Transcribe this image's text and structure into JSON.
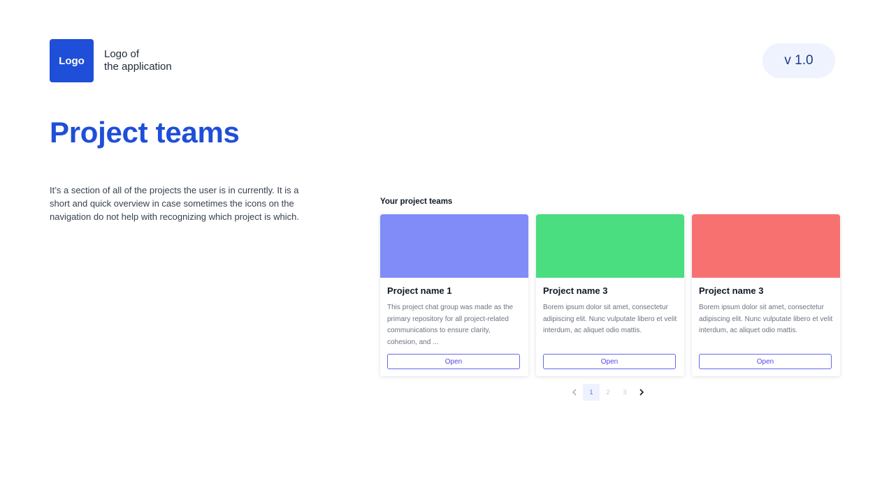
{
  "header": {
    "logo_text": "Logo",
    "logo_caption_line1": "Logo of",
    "logo_caption_line2": "the application",
    "version": "v 1.0"
  },
  "page": {
    "title": "Project teams",
    "description": "It’s a section of all of the projects the user is in currently. It is a short and quick overview in case sometimes the icons on the navigation do not help with recognizing which project is which."
  },
  "teams": {
    "section_title": "Your project teams",
    "cards": [
      {
        "name": "Project name 1",
        "description": "This project chat group was made as the primary repository for all project-related communications to ensure clarity, cohesion, and ...",
        "button": "Open",
        "cover_color": "#818cf8"
      },
      {
        "name": "Project name 3",
        "description": "Borem ipsum dolor sit amet, consectetur adipiscing elit. Nunc vulputate libero et velit interdum, ac aliquet odio mattis.",
        "button": "Open",
        "cover_color": "#4ade80"
      },
      {
        "name": "Project name 3",
        "description": "Borem ipsum dolor sit amet, consectetur adipiscing elit. Nunc vulputate libero et velit interdum, ac aliquet odio mattis.",
        "button": "Open",
        "cover_color": "#f87171"
      }
    ]
  },
  "pagination": {
    "pages": [
      "1",
      "2",
      "3"
    ],
    "current": "1",
    "prev_icon": "chevron-left-icon",
    "next_icon": "chevron-right-icon"
  },
  "colors": {
    "accent": "#1f4fd8",
    "version_bg": "#eef3fd",
    "button_border": "#6366f1"
  }
}
